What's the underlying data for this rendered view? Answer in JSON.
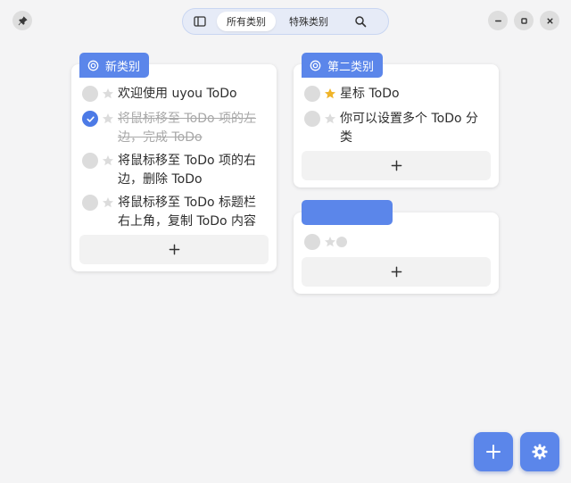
{
  "window": {
    "pin_icon": "pin-icon",
    "minimize_icon": "minimize-icon",
    "maximize_icon": "maximize-icon",
    "close_icon": "close-icon"
  },
  "switcher": {
    "sidebar_icon": "sidebar-toggle-icon",
    "tabs": [
      {
        "label": "所有类别",
        "active": true
      },
      {
        "label": "特殊类别",
        "active": false
      }
    ],
    "search_icon": "search-icon"
  },
  "categories": [
    {
      "name": "新类别",
      "todos": [
        {
          "text": "欢迎使用 uyou ToDo",
          "done": false,
          "starred": false
        },
        {
          "text": "将鼠标移至 ToDo 项的左边，完成 ToDo",
          "done": true,
          "starred": false
        },
        {
          "text": "将鼠标移至 ToDo 项的右边，删除 ToDo",
          "done": false,
          "starred": false
        },
        {
          "text": "将鼠标移至 ToDo 标题栏右上角，复制 ToDo 内容",
          "done": false,
          "starred": false
        }
      ],
      "add_label": "+"
    },
    {
      "name": "第二类别",
      "todos": [
        {
          "text": "星标 ToDo",
          "done": false,
          "starred": true
        },
        {
          "text": "你可以设置多个 ToDo 分类",
          "done": false,
          "starred": false
        }
      ],
      "add_label": "+"
    },
    {
      "name": "",
      "todos": [
        {
          "text": "",
          "done": false,
          "starred": false
        }
      ],
      "add_label": "+"
    }
  ],
  "colors": {
    "accent": "#5b86ea",
    "check_done": "#4c7ae6",
    "star_active": "#f0b429",
    "star_inactive": "#dcdcdc"
  },
  "fab": {
    "add_icon": "plus-icon",
    "settings_icon": "gear-icon"
  }
}
